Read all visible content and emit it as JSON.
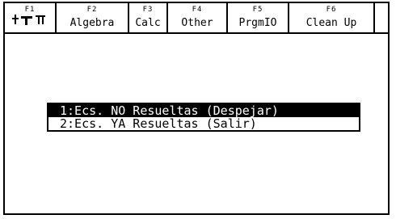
{
  "toolbar": {
    "tabs": [
      {
        "fkey": "F1",
        "label": "",
        "icon": "tools-icon"
      },
      {
        "fkey": "F2",
        "label": "Algebra"
      },
      {
        "fkey": "F3",
        "label": "Calc"
      },
      {
        "fkey": "F4",
        "label": "Other"
      },
      {
        "fkey": "F5",
        "label": "PrgmIO"
      },
      {
        "fkey": "F6",
        "label": "Clean Up"
      },
      {
        "fkey": "",
        "label": ""
      }
    ]
  },
  "menu": {
    "items": [
      {
        "label": "1:Ecs. NO Resueltas (Despejar)",
        "selected": true
      },
      {
        "label": "2:Ecs. YA Resueltas (Salir)",
        "selected": false
      }
    ]
  }
}
